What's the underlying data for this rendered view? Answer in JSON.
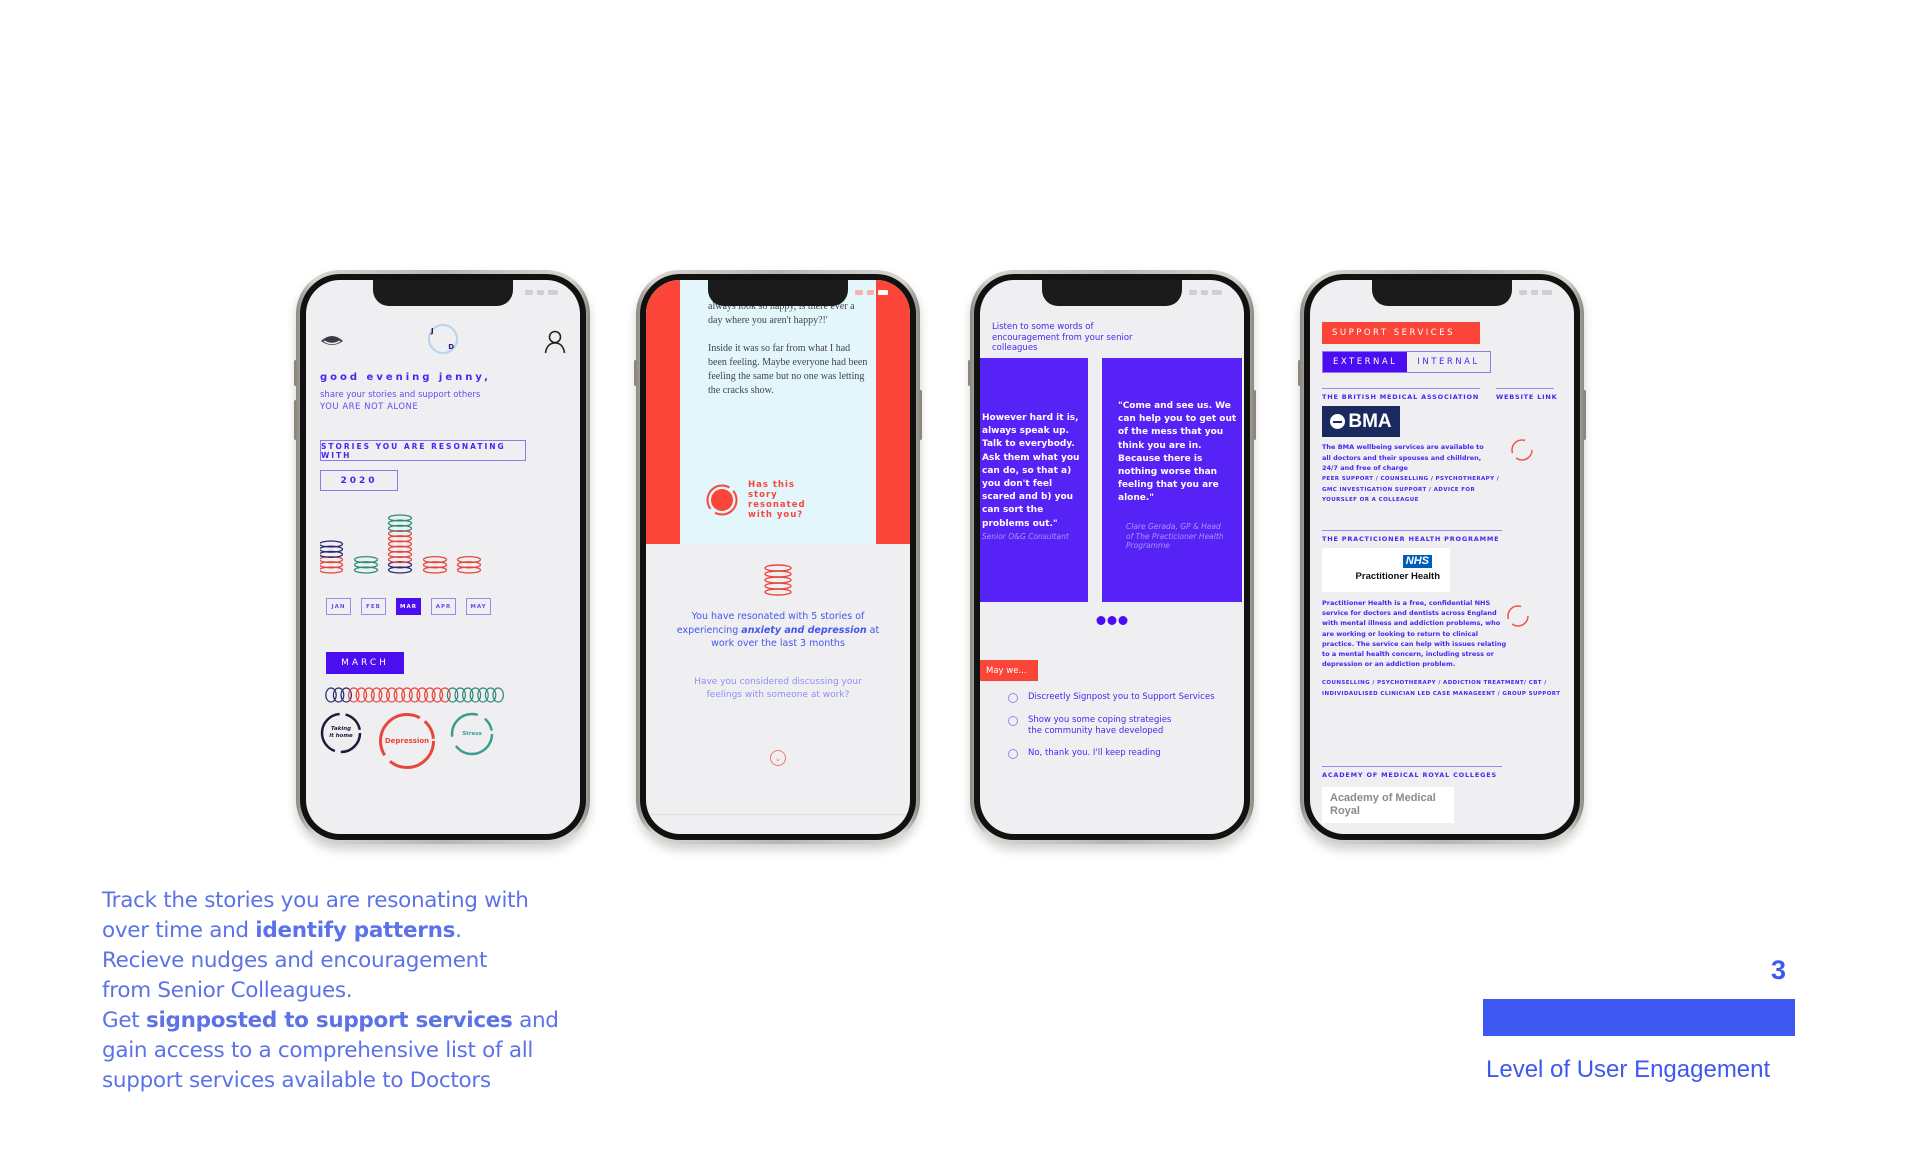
{
  "phones": {
    "dashboard": {
      "avatar_initials": {
        "first": "J",
        "last": "D"
      },
      "greeting": "good evening jenny,",
      "subtitle": "share your stories and support others",
      "tagline": "YOU ARE NOT ALONE",
      "stories_label": "STORIES YOU ARE RESONATING WITH",
      "year": "2020",
      "months": [
        {
          "label": "JAN",
          "active": false
        },
        {
          "label": "FEB",
          "active": false
        },
        {
          "label": "MAR",
          "active": true
        },
        {
          "label": "APR",
          "active": false
        },
        {
          "label": "MAY",
          "active": false
        }
      ],
      "ring_stacks": [
        {
          "month": "JAN",
          "rings": [
            "red",
            "red",
            "red",
            "navy",
            "navy",
            "navy"
          ]
        },
        {
          "month": "FEB",
          "rings": [
            "teal",
            "teal",
            "teal"
          ]
        },
        {
          "month": "MAR",
          "rings": [
            "navy",
            "navy",
            "red",
            "red",
            "red",
            "red",
            "red",
            "red",
            "teal",
            "teal",
            "teal"
          ]
        },
        {
          "month": "APR",
          "rings": [
            "red",
            "red",
            "red"
          ]
        },
        {
          "month": "MAY",
          "rings": [
            "red",
            "red",
            "red"
          ]
        }
      ],
      "selected_month": "MARCH",
      "ring_row": {
        "navy": 3,
        "red": 13,
        "teal": 7
      },
      "topics": [
        {
          "label": "Taking it home",
          "color": "#1b1b3a"
        },
        {
          "label": "Depression",
          "color": "#e8453c"
        },
        {
          "label": "Stress",
          "color": "#3a9d8f"
        }
      ],
      "ring_colors": {
        "red": "#e8453c",
        "navy": "#2a2a6e",
        "teal": "#2f8a78"
      }
    },
    "story": {
      "paragraphs": [
        "always look so happy, is there ever a day where you aren't happy?!'",
        "Inside it was so far from what I had been feeling. Maybe everyone had been feeling the same but no one was letting the cracks show."
      ],
      "resonate_prompt": "Has this story resonated with you?",
      "summary_pre": "You have resonated with 5 stories of experiencing ",
      "summary_bold": "anxiety and depression",
      "summary_post": " at work over the last 3 months",
      "question": "Have you considered discussing your feelings with someone at work?",
      "down_icon": "chevron-down"
    },
    "encouragement": {
      "intro": "Listen to some words of encouragement from your senior colleagues",
      "quotes": [
        {
          "text": "However hard it is, always speak up. Talk to everybody. Ask them what you can do, so that a) you don't feel scared and b) you can sort the problems out.\"",
          "attribution": "Senior O&G Consultant"
        },
        {
          "text": "\"Come and see us. We can help you to get out of the mess that you think you are in. Because there is nothing worse than feeling that you are alone.\"",
          "attribution": "Clare Gerada, GP & Head of The Practicioner Health Programme"
        }
      ],
      "may_we": "May we...",
      "options": [
        "Discreetly Signpost you to Support Services",
        "Show you some coping strategies the community have developed",
        "No, thank you. I'll keep reading"
      ]
    },
    "support": {
      "header": "SUPPORT SERVICES",
      "tabs": [
        {
          "label": "EXTERNAL",
          "active": true
        },
        {
          "label": "INTERNAL",
          "active": false
        }
      ],
      "website_link": "WEBSITE LINK",
      "services": [
        {
          "title": "THE BRITISH MEDICAL ASSOCIATION",
          "logo": "BMA",
          "description": "The BMA wellbeing services are available to all doctors and their spouses and chilldren, 24/7 and free of charge",
          "tags": "PEER SUPPORT / COUNSELLING / PSYCHOTHERAPY / GMC INVESTIGATION SUPPORT / ADVICE FOR YOURSLEF OR A COLLEAGUE"
        },
        {
          "title": "THE PRACTICIONER HEALTH PROGRAMME",
          "logo_badge": "NHS",
          "logo": "Practitioner Health",
          "description": "Practitioner Health is a free, confidential NHS service for doctors and dentists across England with mental illness and addiction problems, who are working or looking to return to clinical practice. The service can help with issues relating to a mental health concern, including stress or depression or an addiction problem.",
          "tags": "COUNSELLING / PSYCHOTHERAPY / ADDICTION TREATMENT/ CBT / INDIVIDAULISED CLINICIAN LED CASE MANAGEENT / GROUP SUPPORT"
        },
        {
          "title": "ACADEMY OF MEDICAL ROYAL COLLEGES",
          "logo": "Academy of Medical Royal"
        }
      ]
    }
  },
  "caption": {
    "l1": "Track the stories you are resonating with",
    "l2_pre": "over time and ",
    "l2_bold": "identify patterns",
    "l2_post": ".",
    "l3": "Recieve nudges and encouragement",
    "l4": "from Senior Colleagues.",
    "l5_pre": "Get ",
    "l5_bold": "signposted to support services",
    "l5_post": " and",
    "l6": "gain access to a comprehensive list of all",
    "l7": "support services available to Doctors"
  },
  "engagement": {
    "level": "3",
    "fill_fraction": 1.0,
    "label": "Level of User Engagement",
    "color": "#3d59f2"
  }
}
